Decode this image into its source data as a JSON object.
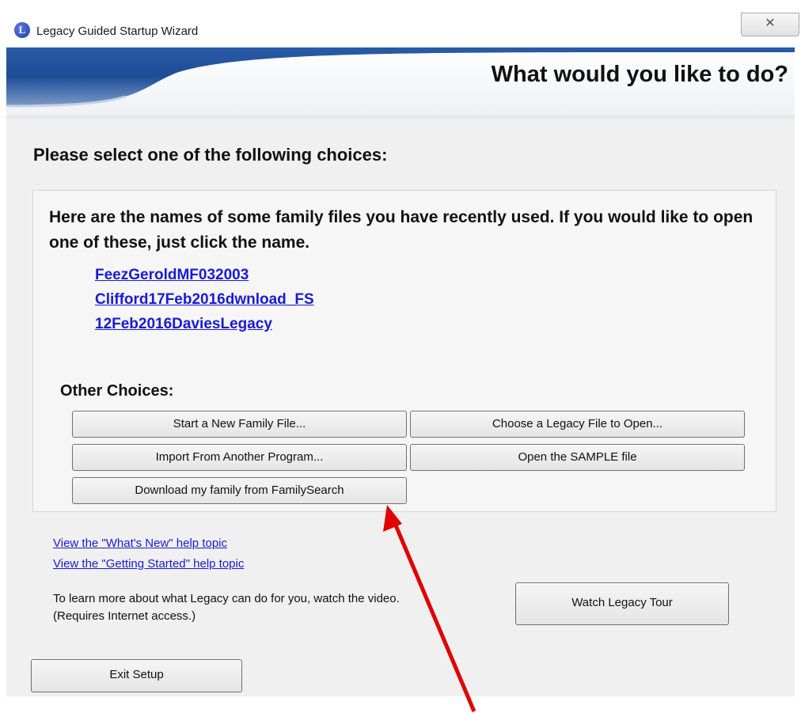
{
  "window": {
    "title": "Legacy Guided Startup Wizard",
    "icon_letter": "L",
    "close_glyph": "✕"
  },
  "header": {
    "headline": "What would you like to do?"
  },
  "main": {
    "instruction": "Please select one of the following choices:",
    "recent": {
      "intro": "Here are the names of some family files you have recently used.  If you would like to open one of these, just click the name.",
      "files": [
        "FeezGeroldMF032003",
        "Clifford17Feb2016dwnload_FS",
        "12Feb2016DaviesLegacy"
      ]
    },
    "other": {
      "heading": "Other Choices:",
      "buttons": [
        "Start a New Family File...",
        "Choose a Legacy File to Open...",
        "Import From Another Program...",
        "Open the SAMPLE file",
        "Download my family from FamilySearch"
      ]
    }
  },
  "help": {
    "whats_new": "View the \"What's New\" help topic",
    "getting_started": "View the \"Getting Started\" help topic",
    "video_line1": "To learn more about what Legacy can do for you, watch the video.",
    "video_line2": "(Requires Internet access.)",
    "tour_button": "Watch Legacy Tour"
  },
  "footer": {
    "exit_button": "Exit Setup"
  },
  "colors": {
    "link": "#1a1ad6",
    "annotation_arrow": "#e00000",
    "banner_blue": "#1f4f9a"
  }
}
